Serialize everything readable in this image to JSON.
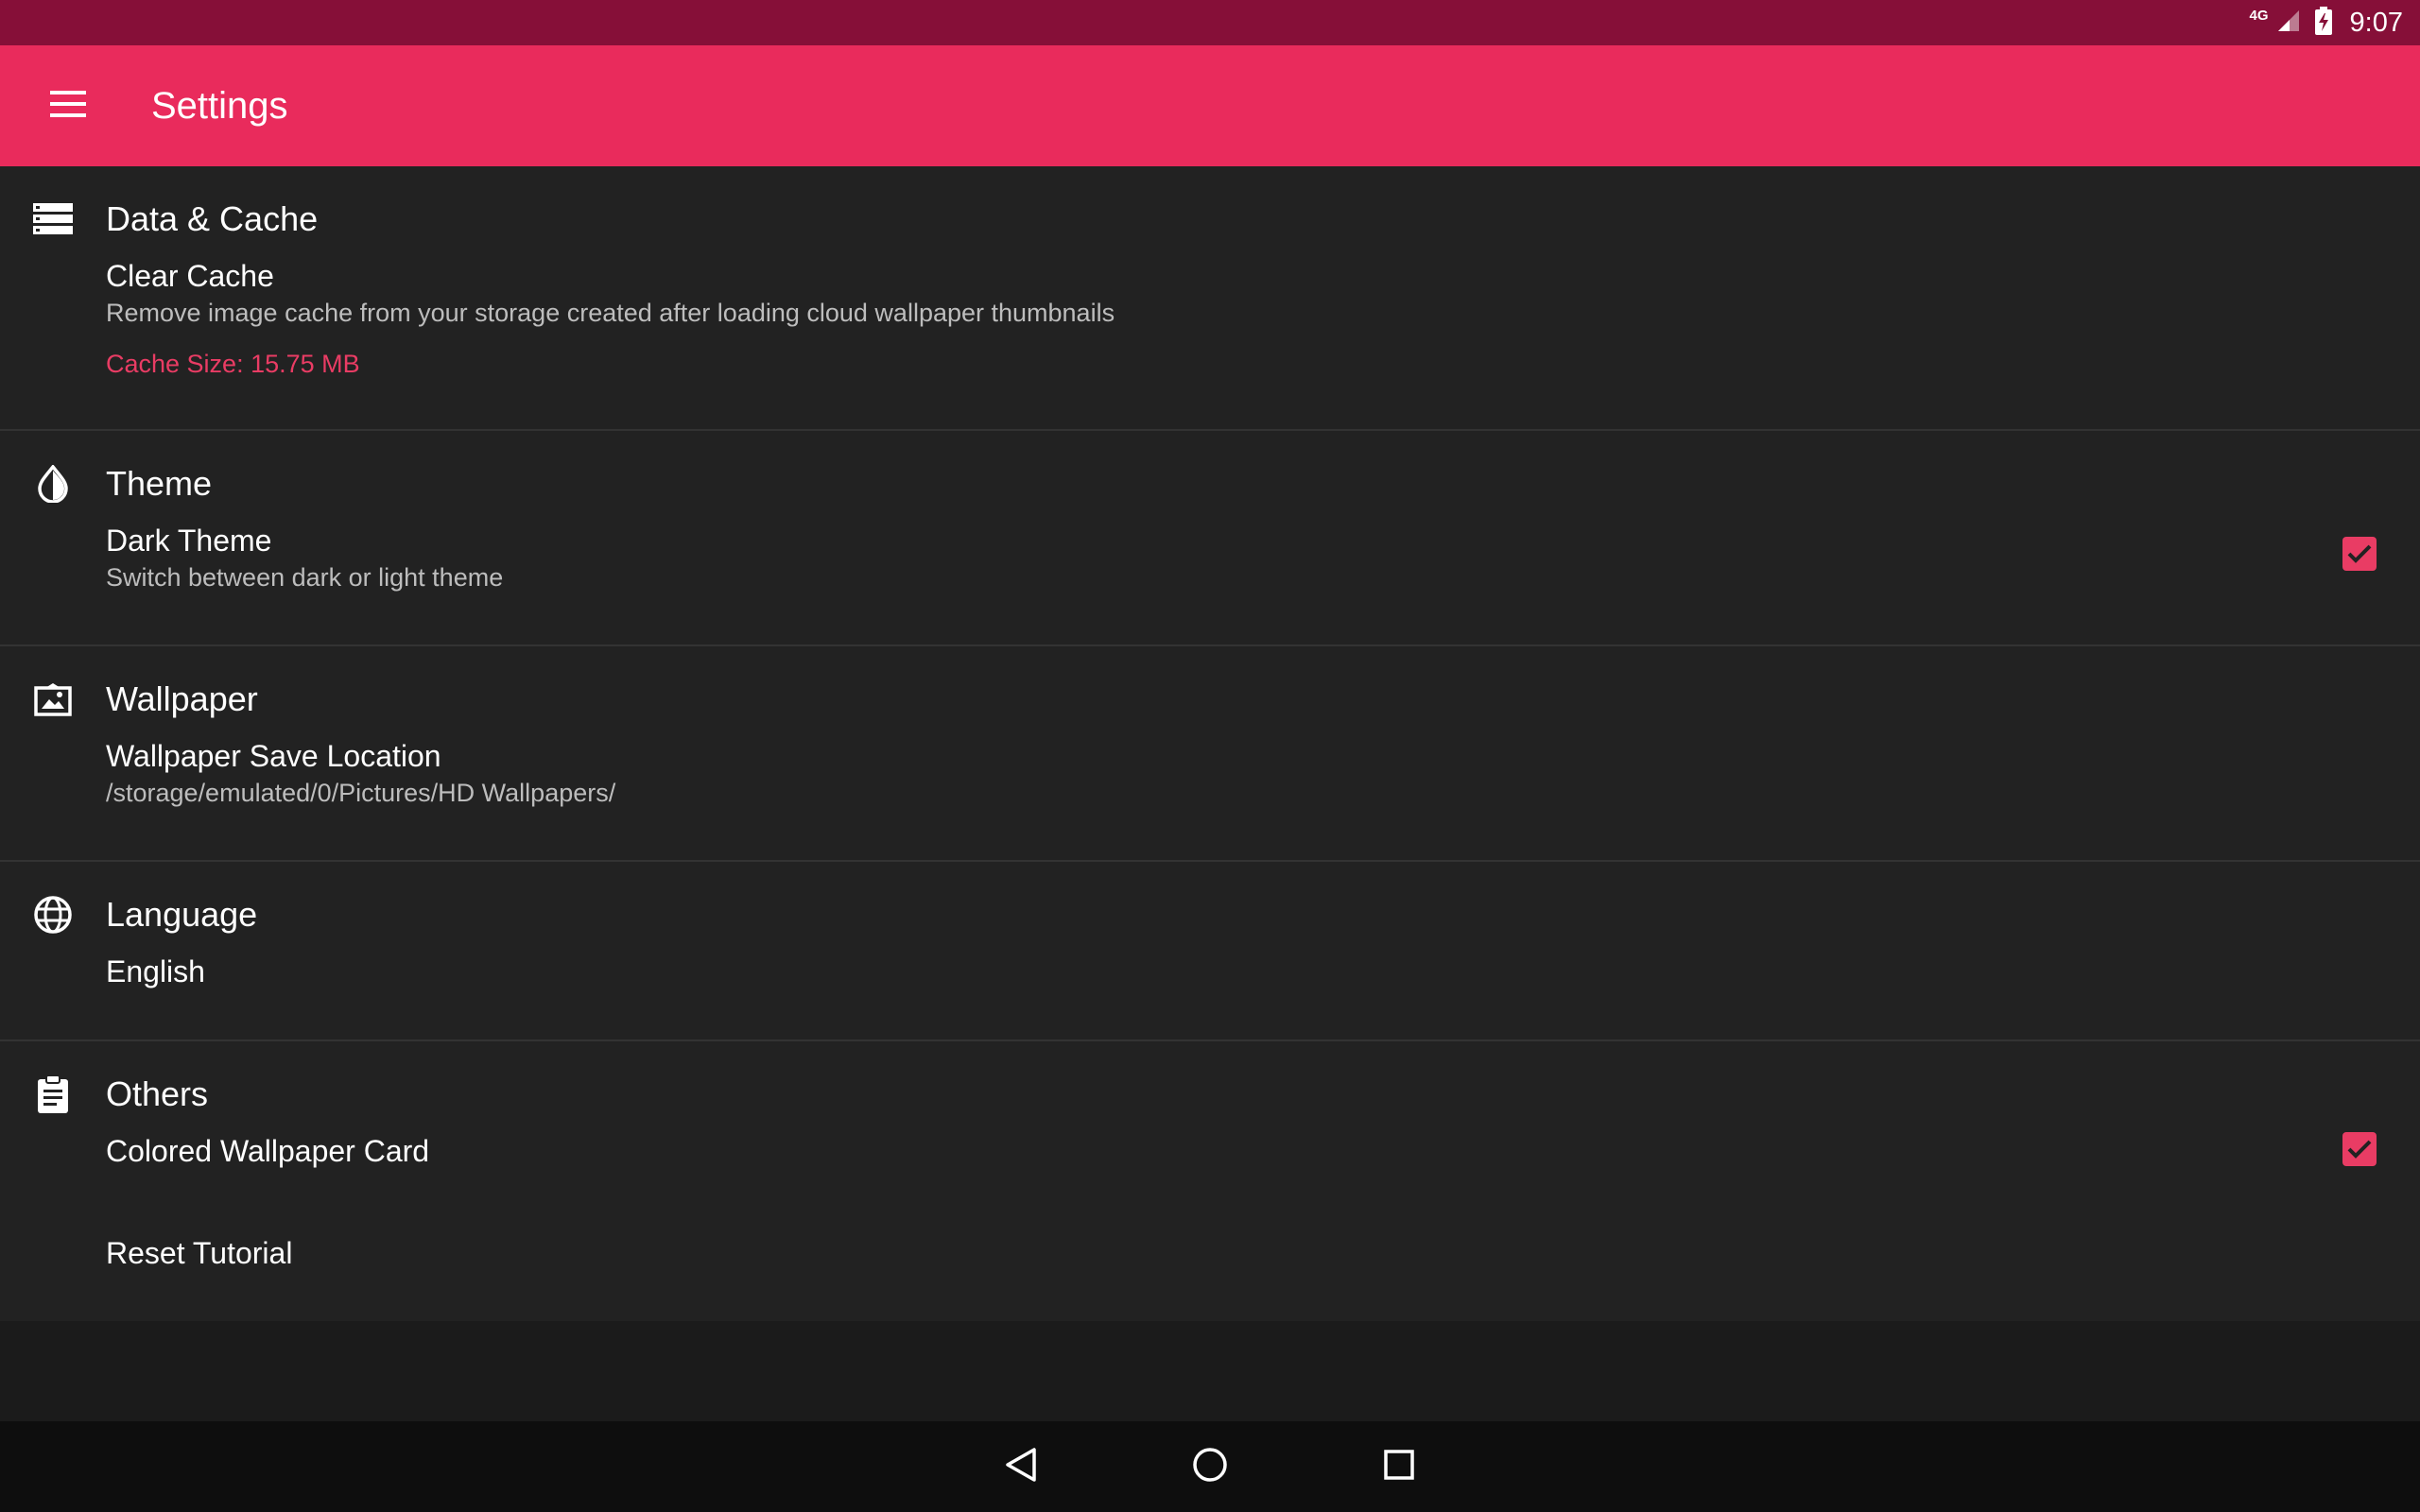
{
  "status_bar": {
    "network": "4G",
    "time": "9:07",
    "icons": [
      "signal-icon",
      "battery-charging-icon"
    ]
  },
  "app_bar": {
    "menu_icon": "hamburger-menu-icon",
    "title": "Settings",
    "background": "#e92b5c"
  },
  "colors": {
    "accent": "#e93c64",
    "status_bar": "#860f38",
    "content_bg": "#222222"
  },
  "sections": {
    "data_cache": {
      "icon": "storage-icon",
      "title": "Data & Cache",
      "clear_cache": {
        "title": "Clear Cache",
        "summary": "Remove image cache from your storage created after loading cloud wallpaper thumbnails",
        "cache_size": "Cache Size: 15.75 MB"
      }
    },
    "theme": {
      "icon": "contrast-icon",
      "title": "Theme",
      "dark_theme": {
        "title": "Dark Theme",
        "summary": "Switch between dark or light theme",
        "checked": true
      }
    },
    "wallpaper": {
      "icon": "wallpaper-icon",
      "title": "Wallpaper",
      "save_location": {
        "title": "Wallpaper Save Location",
        "summary": "/storage/emulated/0/Pictures/HD Wallpapers/"
      }
    },
    "language": {
      "icon": "globe-icon",
      "title": "Language",
      "current": {
        "title": "English"
      }
    },
    "others": {
      "icon": "clipboard-icon",
      "title": "Others",
      "colored_card": {
        "title": "Colored Wallpaper Card",
        "checked": true
      },
      "reset_tutorial": {
        "title": "Reset Tutorial"
      }
    }
  },
  "nav_bar": {
    "buttons": [
      "back-icon",
      "home-icon",
      "recents-icon"
    ]
  }
}
